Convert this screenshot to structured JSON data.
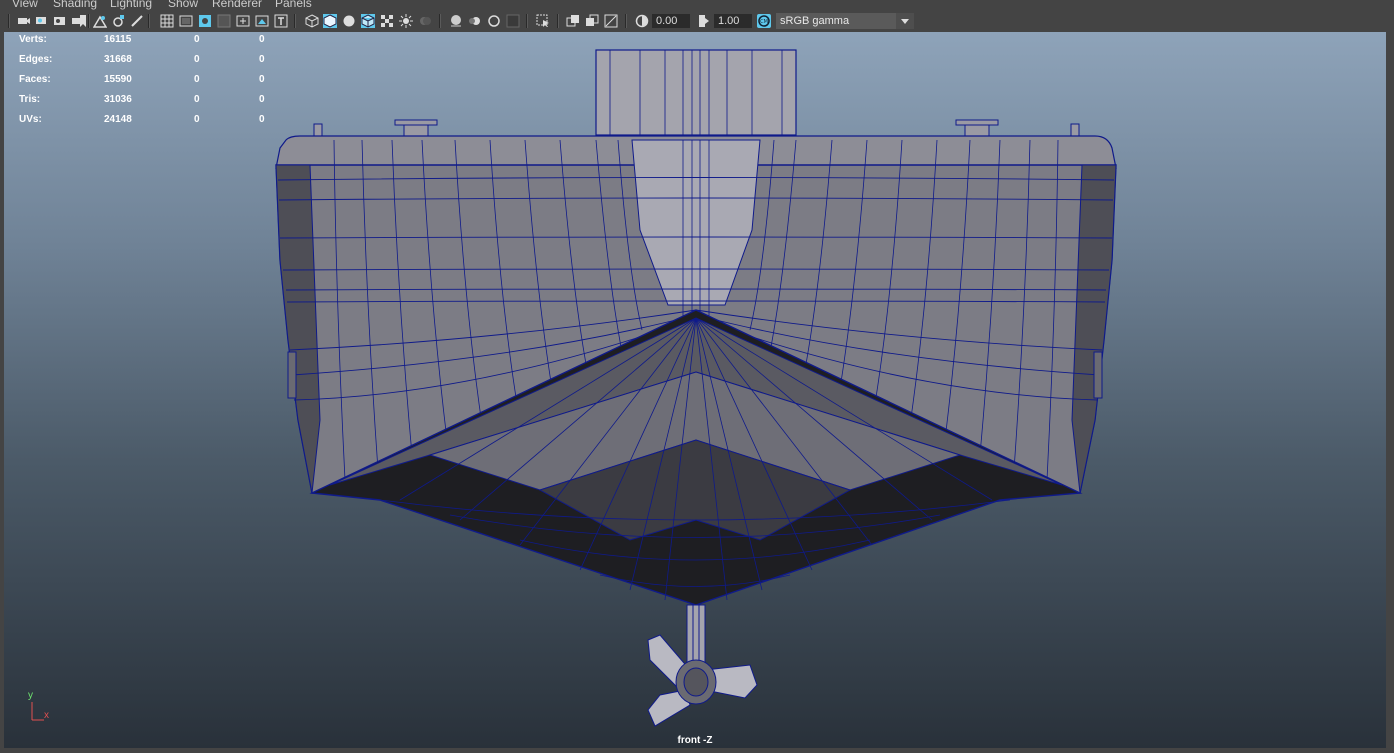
{
  "menu": [
    "View",
    "Shading",
    "Lighting",
    "Show",
    "Renderer",
    "Panels"
  ],
  "toolbar": {
    "exposure": "0.00",
    "gamma": "1.00",
    "color_management": "sRGB gamma"
  },
  "hud": {
    "rows": [
      {
        "label": "Verts:",
        "v1": "16115",
        "v2": "0",
        "v3": "0"
      },
      {
        "label": "Edges:",
        "v1": "31668",
        "v2": "0",
        "v3": "0"
      },
      {
        "label": "Faces:",
        "v1": "15590",
        "v2": "0",
        "v3": "0"
      },
      {
        "label": "Tris:",
        "v1": "31036",
        "v2": "0",
        "v3": "0"
      },
      {
        "label": "UVs:",
        "v1": "24148",
        "v2": "0",
        "v3": "0"
      }
    ]
  },
  "camera_label": "front -Z",
  "axis": {
    "y": "y",
    "x": "x"
  },
  "colors": {
    "wire": "#0f1a8a",
    "accent": "#5ec8ec",
    "axis_y": "#6fe36f",
    "axis_x": "#e05050"
  }
}
